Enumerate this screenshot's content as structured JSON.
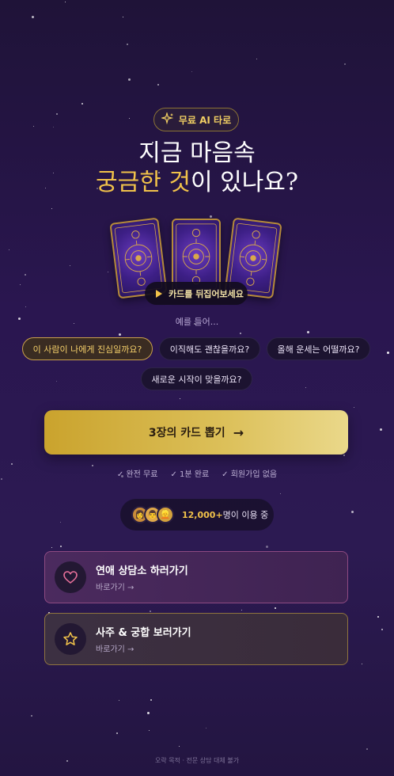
{
  "badge": {
    "label": "무료 AI 타로",
    "icon": "sparkle-icon",
    "color": "#f1cf63"
  },
  "headline": {
    "line1": "지금 마음속",
    "line2_highlight": "궁금한 것",
    "line2_rest": "이 있나요?"
  },
  "cards_preview": {
    "play_label": "카드를 뒤집어보세요",
    "play_icon": "play-icon"
  },
  "examples": {
    "label": "예를 들어...",
    "chips": [
      {
        "label": "이 사람이 나에게 진심일까요?",
        "selected": true
      },
      {
        "label": "이직해도 괜찮을까요?",
        "selected": false
      },
      {
        "label": "올해 운세는 어떨까요?",
        "selected": false
      },
      {
        "label": "새로운 시작이 맞을까요?",
        "selected": false
      }
    ]
  },
  "cta": {
    "label": "3장의 카드 뽑기",
    "icon": "arrow-right-icon"
  },
  "checks": [
    "✓ 완전 무료",
    "✓ 1분 완료",
    "✓ 회원가입 없음"
  ],
  "users": {
    "count": "12,000+",
    "text": "명이 이용 중"
  },
  "links": [
    {
      "title": "연애 상담소 하러가기",
      "sub": "바로가기 →",
      "icon": "heart-icon"
    },
    {
      "title": "사주 & 궁합 보러가기",
      "sub": "바로가기 →",
      "icon": "star-icon"
    }
  ],
  "footer": "오락 목적 · 전문 상담 대체 불가",
  "colors": {
    "gold": "#f1c24a",
    "bg_top": "#1f1338",
    "bg_mid": "#2a1650",
    "pink": "#e7709a"
  }
}
